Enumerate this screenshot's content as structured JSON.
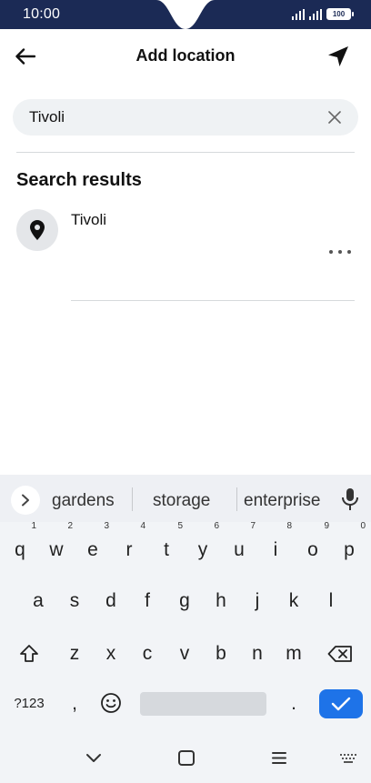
{
  "status_bar": {
    "time": "10:00",
    "battery": "100"
  },
  "header": {
    "title": "Add location"
  },
  "search": {
    "value": "Tivoli",
    "placeholder": ""
  },
  "results": {
    "section_title": "Search results",
    "items": [
      {
        "name": "Tivoli"
      }
    ]
  },
  "keyboard": {
    "suggestions": [
      "gardens",
      "storage",
      "enterprise"
    ],
    "row1": [
      {
        "key": "q",
        "hint": "1"
      },
      {
        "key": "w",
        "hint": "2"
      },
      {
        "key": "e",
        "hint": "3"
      },
      {
        "key": "r",
        "hint": "4"
      },
      {
        "key": "t",
        "hint": "5"
      },
      {
        "key": "y",
        "hint": "6"
      },
      {
        "key": "u",
        "hint": "7"
      },
      {
        "key": "i",
        "hint": "8"
      },
      {
        "key": "o",
        "hint": "9"
      },
      {
        "key": "p",
        "hint": "0"
      }
    ],
    "row2": [
      "a",
      "s",
      "d",
      "f",
      "g",
      "h",
      "j",
      "k",
      "l"
    ],
    "row3": [
      "z",
      "x",
      "c",
      "v",
      "b",
      "n",
      "m"
    ],
    "symbols_key": "?123",
    "comma_key": ",",
    "period_key": "."
  },
  "colors": {
    "status_bar_bg": "#1b2a55",
    "enter_key": "#1e73e8",
    "search_bg": "#eff2f4"
  },
  "icons": [
    "back-arrow-icon",
    "navigation-arrow-icon",
    "close-icon",
    "location-pin-icon",
    "more-icon",
    "chevron-right-icon",
    "mic-icon",
    "shift-icon",
    "backspace-icon",
    "emoji-icon",
    "check-icon",
    "nav-back-icon",
    "nav-home-icon",
    "nav-recents-icon",
    "keyboard-icon"
  ]
}
